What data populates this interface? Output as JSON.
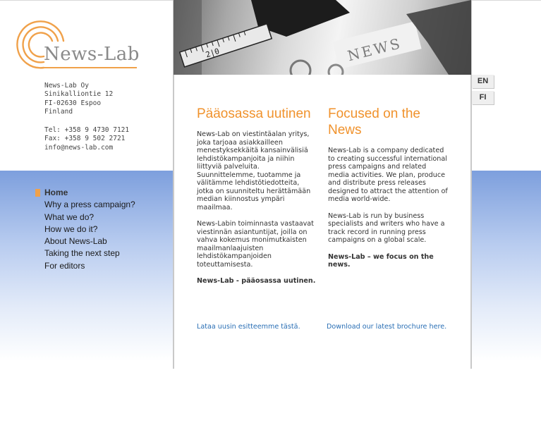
{
  "brand": {
    "name": "News-Lab",
    "accent": "#f0922c",
    "text_grey": "#8a8a8a"
  },
  "address": {
    "company": "News-Lab Oy",
    "street": "Sinikalliontie 12",
    "postal": "FI-02630 Espoo",
    "country": "Finland",
    "tel": "Tel: +358 9 4730 7121",
    "fax": "Fax: +358 9 502 2721",
    "email": "info@news-lab.com"
  },
  "nav": {
    "items": [
      {
        "label": "Home",
        "active": true
      },
      {
        "label": "Why a press campaign?"
      },
      {
        "label": "What we do?"
      },
      {
        "label": "How we do it?"
      },
      {
        "label": "About News-Lab"
      },
      {
        "label": "Taking the next step"
      },
      {
        "label": "For editors"
      }
    ]
  },
  "hero": {
    "tick_label": "2|0",
    "stamp_text": "NEWS",
    "icon": "typewriter-photo"
  },
  "languages": [
    "EN",
    "FI"
  ],
  "fi": {
    "title": "Pääosassa uutinen",
    "p1": "News-Lab on viestintäalan yritys, joka tarjoaa asiakkailleen menestyksekkäitä kansainvälisiä lehdistökampanjoita ja niihin liittyviä palveluita. Suunnittelemme, tuotamme ja välitämme lehdistötiedotteita, jotka on suunniteltu herättämään median kiinnostus ympäri maailmaa.",
    "p2": "News-Labin toiminnasta vastaavat viestinnän asiantuntijat, joilla on vahva kokemus monimutkaisten maailmanlaajuisten lehdistökampanjoiden toteuttamisesta.",
    "tagline": "News-Lab - pääosassa uutinen.",
    "link": "Lataa uusin esitteemme tästä."
  },
  "en": {
    "title": "Focused on the News",
    "p1": "News-Lab is a company dedicated to creating successful international press campaigns and related media activities. We plan, produce and distribute press releases designed to attract the attention of media world-wide.",
    "p2": "News-Lab is run by business specialists and writers who have a track record in running press campaigns on a global scale.",
    "tagline": "News-Lab – we focus on the news.",
    "link": "Download our latest brochure here."
  }
}
